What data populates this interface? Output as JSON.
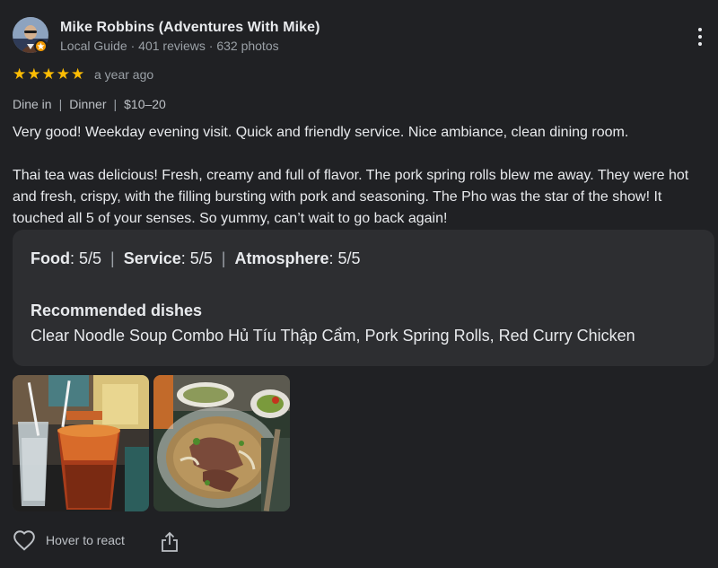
{
  "reviewer": {
    "name": "Mike Robbins (Adventures With Mike)",
    "badge": "Local Guide",
    "reviews": "401 reviews",
    "photos": "632 photos",
    "separator": "·",
    "avatar_icon": "user-avatar",
    "badge_icon": "local-guide-star"
  },
  "rating": {
    "value": 5,
    "max": 5,
    "star": "★",
    "time": "a year ago",
    "color": "#fbbc04"
  },
  "attributes": [
    "Dine in",
    "Dinner",
    "$10–20"
  ],
  "attr_separator": "|",
  "review": {
    "para1": "Very good! Weekday evening visit. Quick and friendly service. Nice ambiance, clean dining room.",
    "para2": "Thai tea was delicious! Fresh, creamy and full of flavor. The pork spring rolls blew me away. They were hot and fresh, crispy, with the filling bursting with pork and seasoning. The Pho was the star of the show! It touched all 5 of your senses. So yummy, can’t wait to go back again!"
  },
  "summary": {
    "food_label": "Food",
    "food_value": ": 5/5",
    "service_label": "Service",
    "service_value": ": 5/5",
    "atmosphere_label": "Atmosphere",
    "atmosphere_value": ": 5/5",
    "separator": "|",
    "recommended_title": "Recommended dishes",
    "recommended_dishes": "Clear Noodle Soup Combo Hủ Tíu Thập Cẩm, Pork Spring Rolls, Red Curry Chicken"
  },
  "photos": [
    {
      "icon": "thai-tea-photo"
    },
    {
      "icon": "pho-photo"
    }
  ],
  "actions": {
    "react_label": "Hover to react",
    "react_icon": "heart-icon",
    "share_icon": "share-icon",
    "more_icon": "more-vert-icon"
  },
  "colors": {
    "background": "#202124",
    "card": "#2d2e31",
    "text": "#e8eaed",
    "muted": "#9aa0a6",
    "badge": "#f29900"
  }
}
